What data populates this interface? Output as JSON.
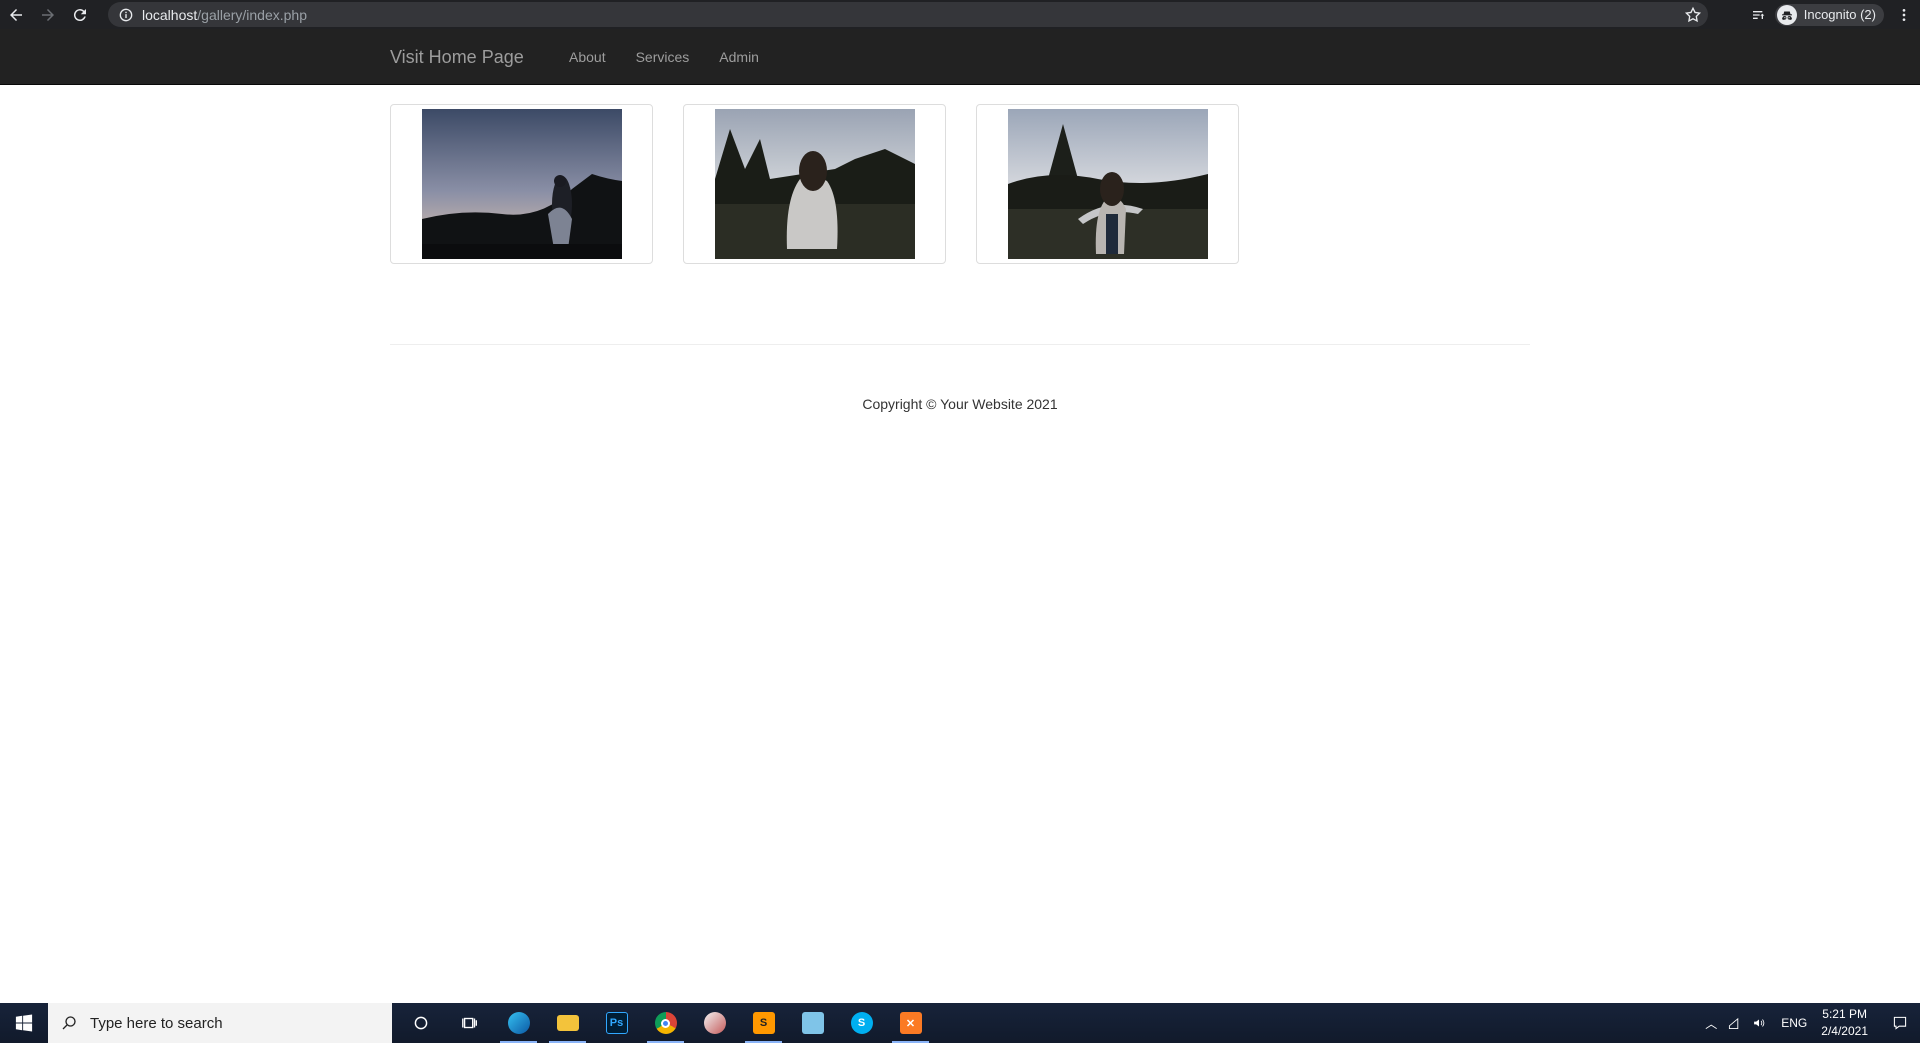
{
  "browser": {
    "url_host": "localhost",
    "url_path": "/gallery/index.php",
    "profile_label": "Incognito (2)"
  },
  "navbar": {
    "brand": "Visit Home Page",
    "links": [
      {
        "label": "About"
      },
      {
        "label": "Services"
      },
      {
        "label": "Admin"
      }
    ]
  },
  "gallery": {
    "items": [
      {
        "name": "photo-1"
      },
      {
        "name": "photo-2"
      },
      {
        "name": "photo-3"
      }
    ]
  },
  "footer": {
    "copyright": "Copyright © Your Website 2021"
  },
  "taskbar": {
    "search_placeholder": "Type here to search",
    "language": "ENG",
    "time": "5:21 PM",
    "date": "2/4/2021",
    "apps": [
      "cortana-icon",
      "task-view-icon",
      "edge-icon",
      "file-explorer-icon",
      "photoshop-icon",
      "chrome-icon",
      "app-icon",
      "sublime-text-icon",
      "notepad-icon",
      "skype-icon",
      "xampp-icon"
    ]
  }
}
